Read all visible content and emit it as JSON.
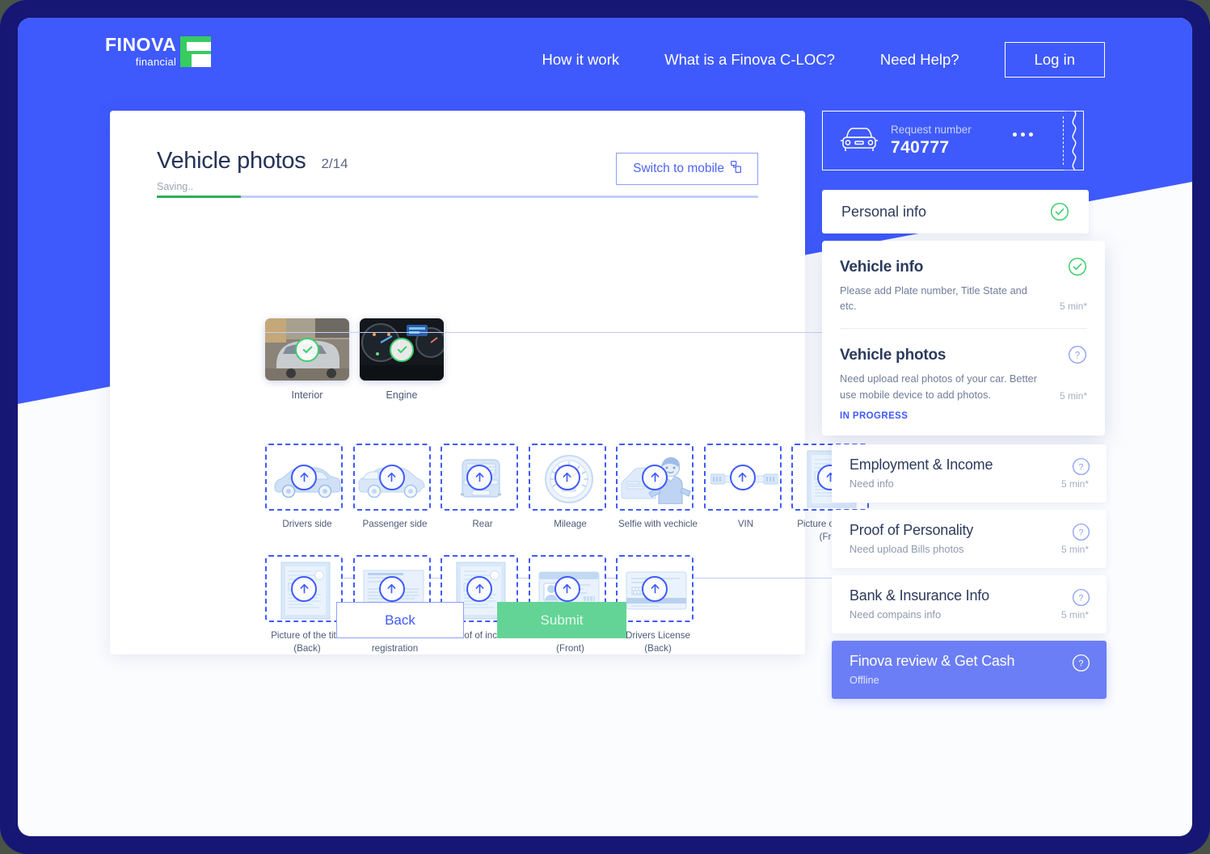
{
  "colors": {
    "brand_blue": "#3f5afc",
    "accent_green": "#36cc5f",
    "submit_green": "#63d495",
    "frame_navy": "#161675",
    "active_step": "#6b7ef5"
  },
  "brand": {
    "name": "FINOVA",
    "tagline": "financial",
    "logo_icon": "finova-f-logo-icon"
  },
  "nav": {
    "links": [
      {
        "label": "How it work"
      },
      {
        "label": "What is a Finova C-LOC?"
      },
      {
        "label": "Need Help?"
      }
    ],
    "login_label": "Log in"
  },
  "main": {
    "title": "Vehicle photos",
    "count": "2/14",
    "switch_label": "Switch to mobile",
    "switch_icon": "mobile-device-icon",
    "saving_text": "Saving..",
    "progress_percent": 14,
    "uploaded": [
      {
        "label": "Interior",
        "status_icon": "check-circle-icon"
      },
      {
        "label": "Engine",
        "status_icon": "check-circle-icon"
      }
    ],
    "uploads": [
      {
        "label": "Drivers side",
        "art": "car-side-icon"
      },
      {
        "label": "Passenger side",
        "art": "car-passenger-icon"
      },
      {
        "label": "Rear",
        "art": "car-rear-icon"
      },
      {
        "label": "Mileage",
        "art": "gauge-icon"
      },
      {
        "label": "Selfie with vechicle",
        "art": "person-with-car-icon"
      },
      {
        "label": "VIN",
        "art": "vin-plate-icon"
      },
      {
        "label": "Picture of the title\n(Front)",
        "art": "document-portrait-icon"
      },
      {
        "label": "Picture of the title\n(Back)",
        "art": "document-portrait-icon"
      },
      {
        "label": "Picture of\nregistration",
        "art": "document-landscape-icon"
      },
      {
        "label": "Proof of income",
        "art": "document-portrait-icon"
      },
      {
        "label": "Drivers license\n(Front)",
        "art": "id-card-front-icon"
      },
      {
        "label": "Drivers License\n(Back)",
        "art": "id-card-back-icon"
      }
    ],
    "back_label": "Back",
    "submit_label": "Submit"
  },
  "sidebar": {
    "ticket": {
      "caption": "Request number",
      "number": "740777",
      "car_icon": "car-front-icon",
      "menu_icon": "ellipsis-icon"
    },
    "personal": {
      "title": "Personal info",
      "mark": "check-circle-icon"
    },
    "expanded": [
      {
        "title": "Vehicle info",
        "desc": "Please add Plate number, Title State and etc.",
        "time": "5 min*",
        "mark": "check-circle-icon",
        "badge": ""
      },
      {
        "title": "Vehicle photos",
        "desc": "Need upload real photos of your car. Better use mobile device to add photos.",
        "time": "5 min*",
        "mark": "question-circle-icon",
        "badge": "IN PROGRESS"
      }
    ],
    "steps": [
      {
        "title": "Employment & Income",
        "desc": "Need info",
        "time": "5 min*",
        "mark": "question-circle-icon",
        "active": false
      },
      {
        "title": "Proof of Personality",
        "desc": "Need upload Bills photos",
        "time": "5 min*",
        "mark": "question-circle-icon",
        "active": false
      },
      {
        "title": "Bank & Insurance Info",
        "desc": "Need compains info",
        "time": "5 min*",
        "mark": "question-circle-icon",
        "active": false
      },
      {
        "title": "Finova review & Get Cash",
        "desc": "Offline",
        "time": "",
        "mark": "question-circle-icon",
        "active": true
      }
    ]
  }
}
